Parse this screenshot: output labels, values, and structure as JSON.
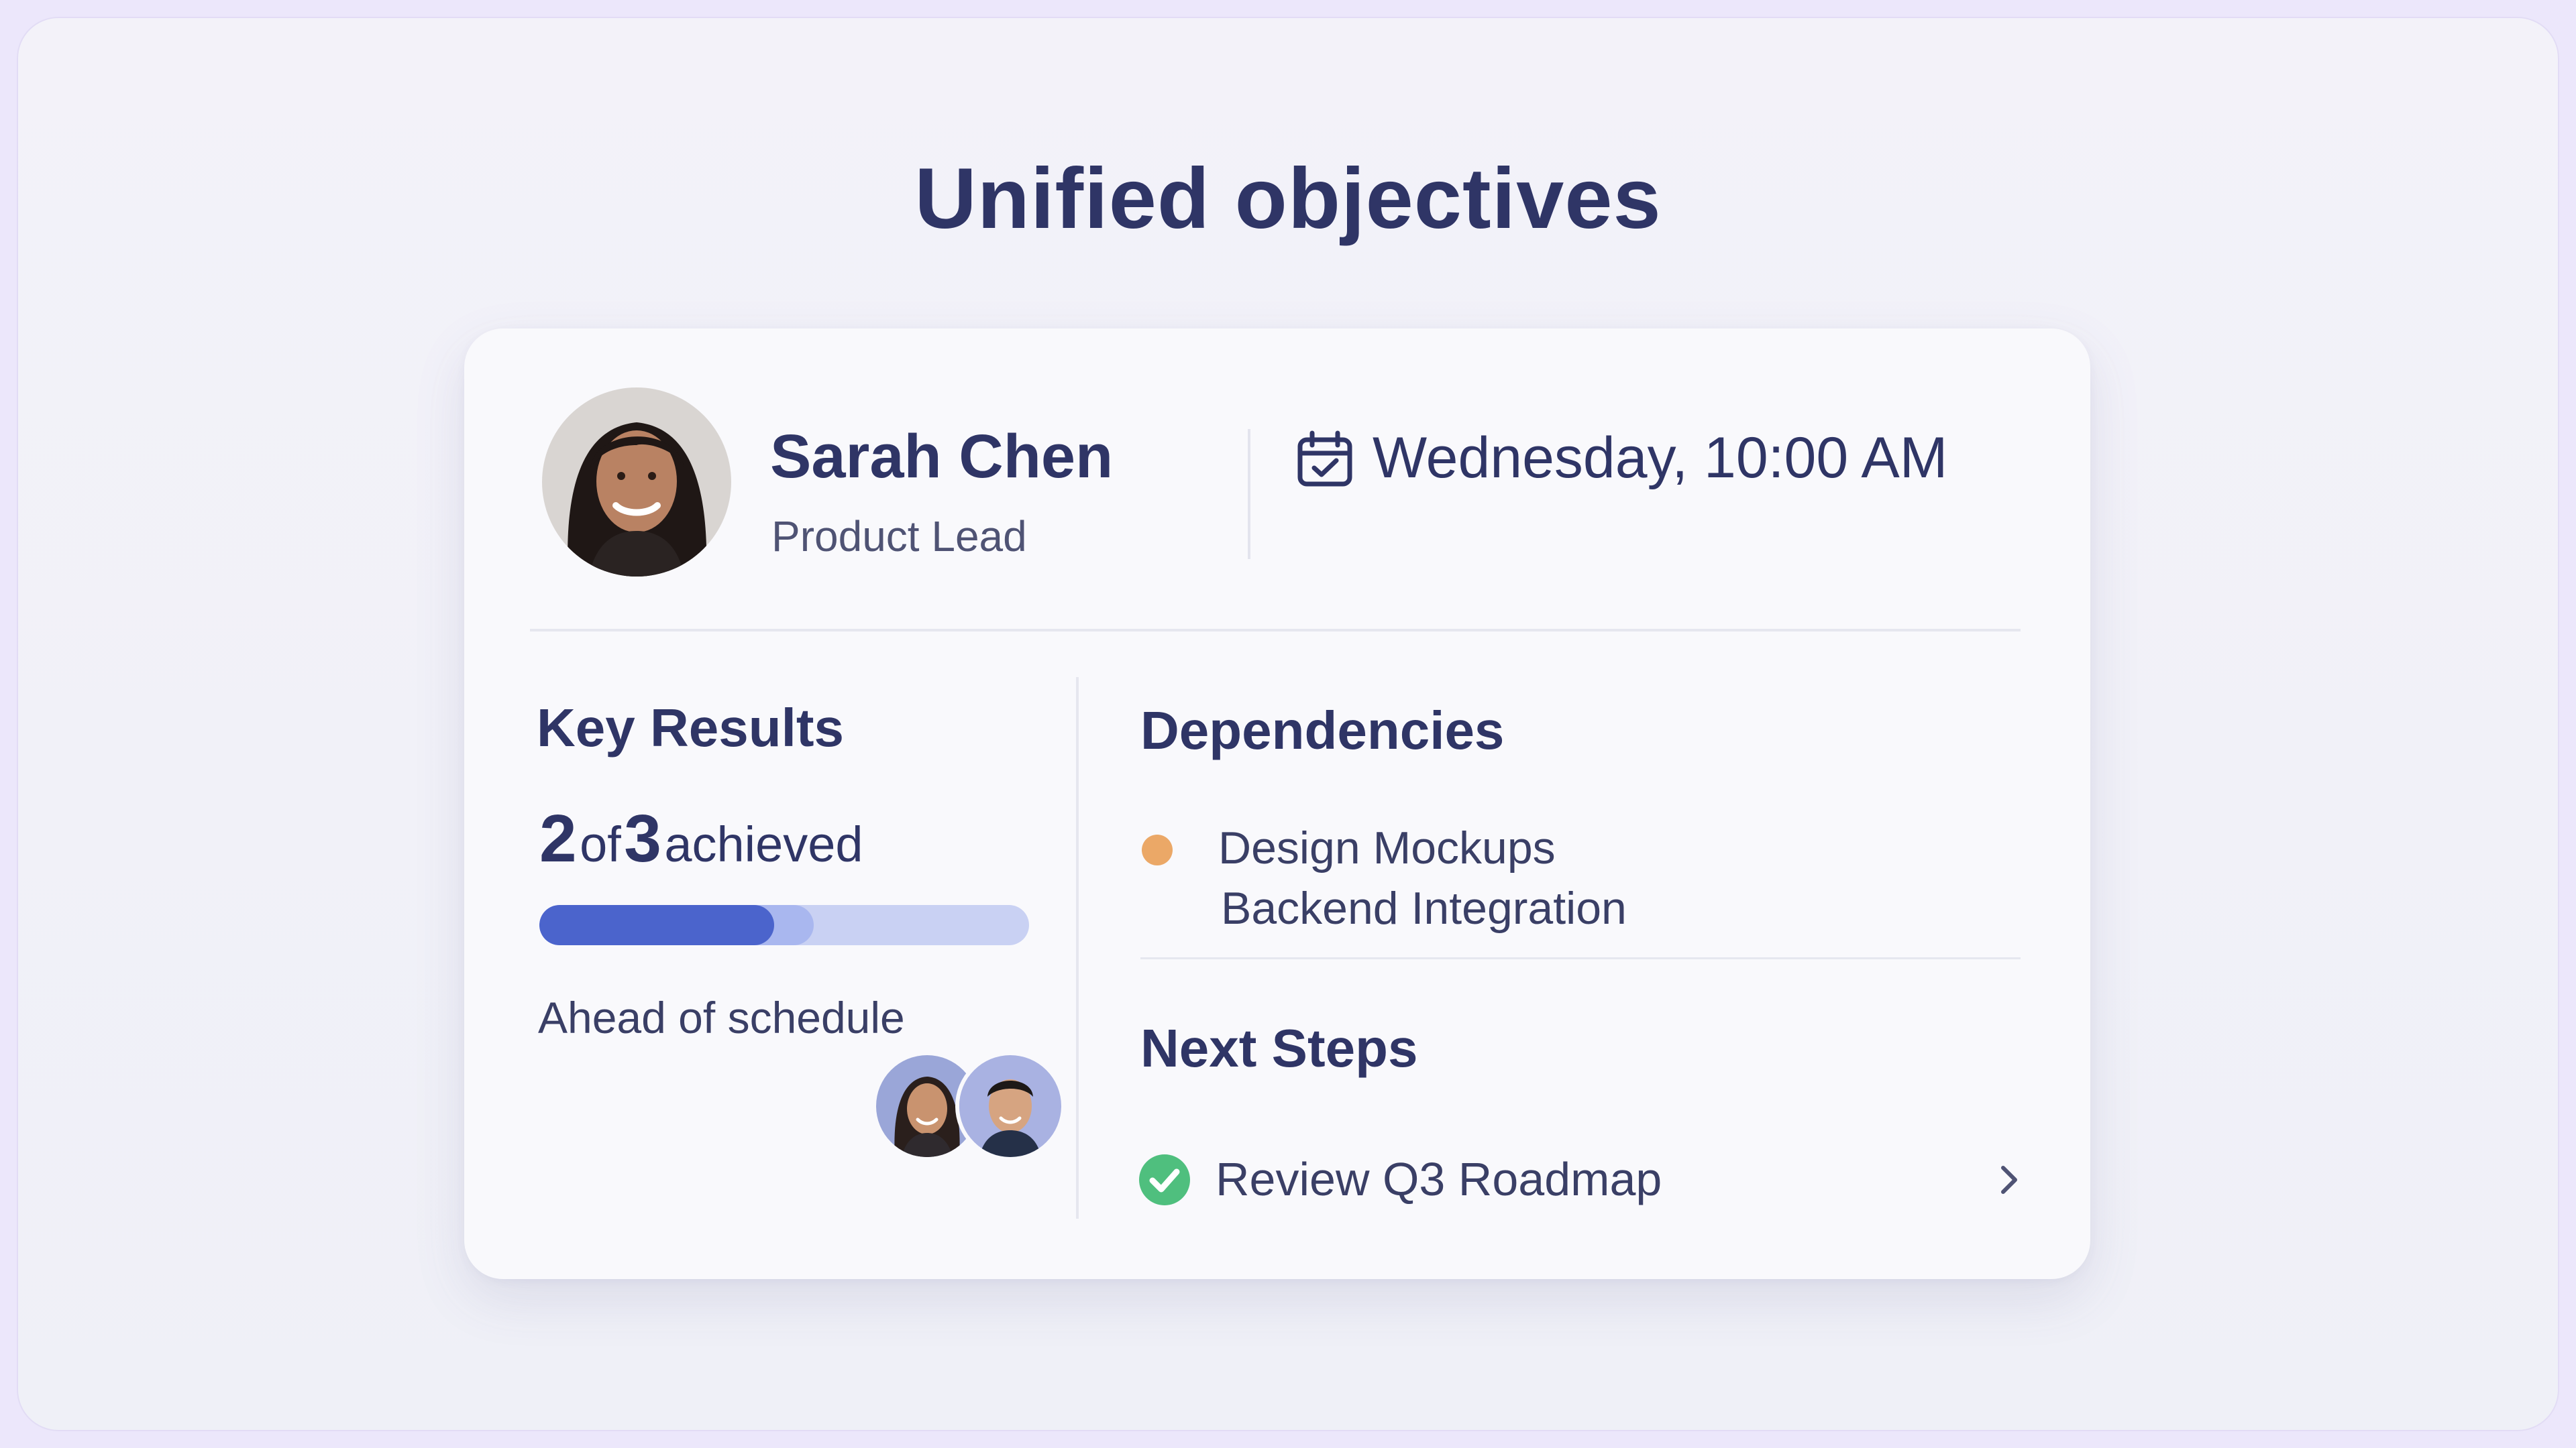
{
  "headline": "Unified objectives",
  "profile": {
    "name": "Sarah Chen",
    "role": "Product Lead"
  },
  "meeting": {
    "icon": "calendar-check-icon",
    "datetime": "Wednesday, 10:00 AM"
  },
  "key_results": {
    "title": "Key Results",
    "achieved": "2",
    "of_label": "of",
    "total": "3",
    "achieved_label": "achieved",
    "progress_fraction": 0.48,
    "progress_secondary_fraction": 0.56,
    "status": "Ahead of schedule",
    "collaborators": [
      "woman-avatar",
      "man-avatar"
    ]
  },
  "dependencies": {
    "title": "Dependencies",
    "status_color": "#eba867",
    "items": [
      "Design Mockups",
      "Backend Integration"
    ]
  },
  "next_steps": {
    "title": "Next Steps",
    "item": "Review Q3 Roadmap",
    "check_color": "#4fbf7e",
    "icon": "chevron-right-icon"
  },
  "colors": {
    "primary_text": "#2f3566",
    "accent": "#4b64cc",
    "background": "#f1f1f8"
  }
}
